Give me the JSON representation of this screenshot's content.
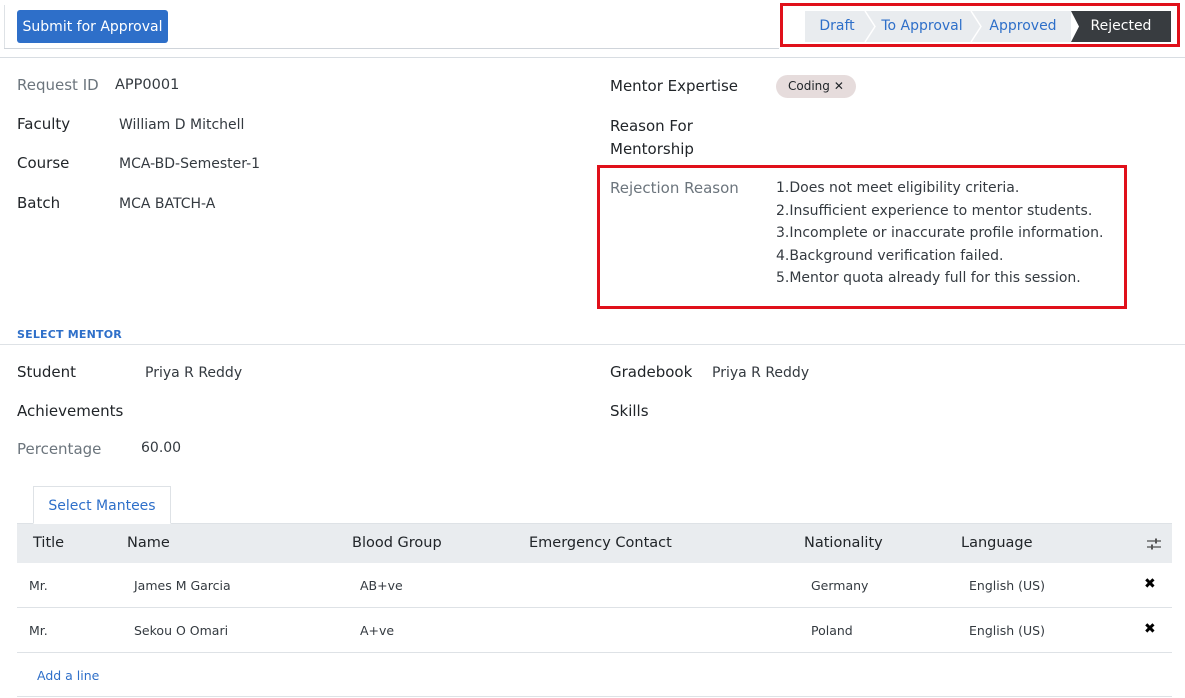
{
  "header": {
    "submit_label": "Submit for Approval",
    "stages": [
      "Draft",
      "To Approval",
      "Approved",
      "Rejected"
    ],
    "active_stage": "Rejected"
  },
  "form": {
    "request_id_label": "Request ID",
    "request_id_value": "APP0001",
    "faculty_label": "Faculty",
    "faculty_value": "William D Mitchell",
    "course_label": "Course",
    "course_value": "MCA-BD-Semester-1",
    "batch_label": "Batch",
    "batch_value": "MCA BATCH-A",
    "mentor_expertise_label": "Mentor Expertise",
    "mentor_expertise_tag": "Coding",
    "reason_label_line1": "Reason For",
    "reason_label_line2": "Mentorship",
    "rejection_label": "Rejection Reason",
    "rejection_lines": [
      "1.Does not meet eligibility criteria.",
      "2.Insufficient experience to mentor students.",
      "3.Incomplete or inaccurate profile information.",
      "4.Background verification failed.",
      "5.Mentor quota already full for this session."
    ]
  },
  "select_mentor": {
    "section_title": "SELECT MENTOR",
    "student_label": "Student",
    "student_value": "Priya R Reddy",
    "gradebook_label": "Gradebook",
    "gradebook_value": "Priya R Reddy",
    "achievements_label": "Achievements",
    "skills_label": "Skills",
    "percentage_label": "Percentage",
    "percentage_value": "60.00"
  },
  "mentees": {
    "tab_label": "Select Mantees",
    "columns": [
      "Title",
      "Name",
      "Blood Group",
      "Emergency Contact",
      "Nationality",
      "Language"
    ],
    "rows": [
      {
        "title": "Mr.",
        "name": "James M Garcia",
        "blood_group": "AB+ve",
        "emergency_contact": "",
        "nationality": "Germany",
        "language": "English (US)"
      },
      {
        "title": "Mr.",
        "name": "Sekou O Omari",
        "blood_group": "A+ve",
        "emergency_contact": "",
        "nationality": "Poland",
        "language": "English (US)"
      }
    ],
    "add_line_label": "Add a line",
    "delete_glyph": "✖",
    "icons": {
      "column_settings": "sliders-icon",
      "delete": "close-icon",
      "tag_remove": "close-icon"
    }
  }
}
